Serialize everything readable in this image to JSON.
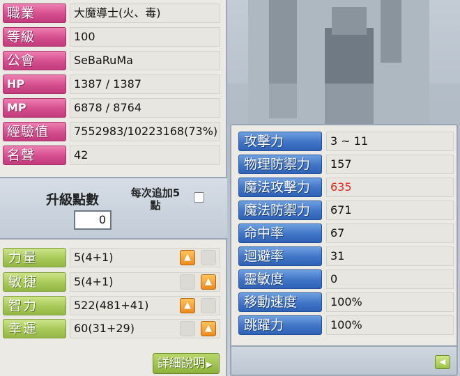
{
  "info": [
    {
      "label": "職業",
      "value": "大魔導士(火、毒)"
    },
    {
      "label": "等級",
      "value": "100"
    },
    {
      "label": "公會",
      "value": "SeBaRuMa"
    },
    {
      "label": "HP",
      "value": "1387 / 1387"
    },
    {
      "label": "MP",
      "value": "6878 / 8764"
    },
    {
      "label": "經驗值",
      "value": "7552983/10223168(73%)"
    },
    {
      "label": "名聲",
      "value": "42"
    }
  ],
  "points": {
    "title": "升級點數",
    "value": "0",
    "add5_label": "每次追加5點"
  },
  "stats": [
    {
      "label": "力量",
      "value": "5(4+1)"
    },
    {
      "label": "敏捷",
      "value": "5(4+1)"
    },
    {
      "label": "智力",
      "value": "522(481+41)"
    },
    {
      "label": "幸運",
      "value": "60(31+29)"
    }
  ],
  "detail_button": "詳細說明",
  "details": [
    {
      "label": "攻擊力",
      "value": "3 ~ 11",
      "color": "#111111"
    },
    {
      "label": "物理防禦力",
      "value": "157",
      "color": "#111111"
    },
    {
      "label": "魔法攻擊力",
      "value": "635",
      "color": "#e8281e"
    },
    {
      "label": "魔法防禦力",
      "value": "671",
      "color": "#111111"
    },
    {
      "label": "命中率",
      "value": "67",
      "color": "#111111"
    },
    {
      "label": "迴避率",
      "value": "31",
      "color": "#111111"
    },
    {
      "label": "靈敏度",
      "value": "0",
      "color": "#111111"
    },
    {
      "label": "移動速度",
      "value": "100%",
      "color": "#111111"
    },
    {
      "label": "跳躍力",
      "value": "100%",
      "color": "#111111"
    }
  ],
  "colors": {
    "pink_label": "#d44d8d",
    "green_label": "#a7c957",
    "blue_label": "#3f74c6",
    "highlight_value": "#e8281e",
    "up_button": "#f08a1c"
  },
  "icons": {
    "up_button": "up-arrow-icon",
    "back_button": "left-arrow-icon",
    "detail_button": "right-triangle-icon"
  }
}
